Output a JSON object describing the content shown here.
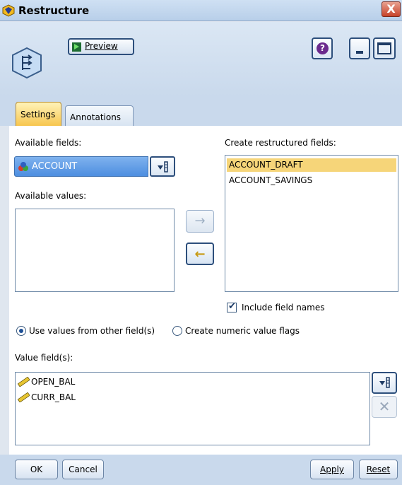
{
  "window": {
    "title": "Restructure",
    "close_glyph": "X"
  },
  "toolbar": {
    "preview_label": "Preview",
    "help_glyph": "?"
  },
  "tabs": [
    {
      "label": "Settings",
      "active": true
    },
    {
      "label": "Annotations",
      "active": false
    }
  ],
  "available_fields": {
    "label": "Available fields:",
    "selected": "ACCOUNT",
    "icon": "nominal-field-icon"
  },
  "available_values": {
    "label": "Available values:",
    "items": []
  },
  "restructured": {
    "label": "Create restructured fields:",
    "items": [
      "ACCOUNT_DRAFT",
      "ACCOUNT_SAVINGS"
    ],
    "selected_index": 0
  },
  "include_field_names": {
    "label": "Include field names",
    "checked": true
  },
  "mode": {
    "use_values_label": "Use values from other field(s)",
    "numeric_flags_label": "Create numeric value flags",
    "selected": "use_values"
  },
  "value_fields": {
    "label": "Value field(s):",
    "items": [
      "OPEN_BAL",
      "CURR_BAL"
    ],
    "icon": "continuous-ruler-icon"
  },
  "buttons": {
    "ok": "OK",
    "cancel": "Cancel",
    "apply": "Apply",
    "reset": "Reset"
  },
  "colors": {
    "selection": "#f6d579",
    "accent": "#4d8ee0",
    "settings_tab": "#f7c64f"
  }
}
